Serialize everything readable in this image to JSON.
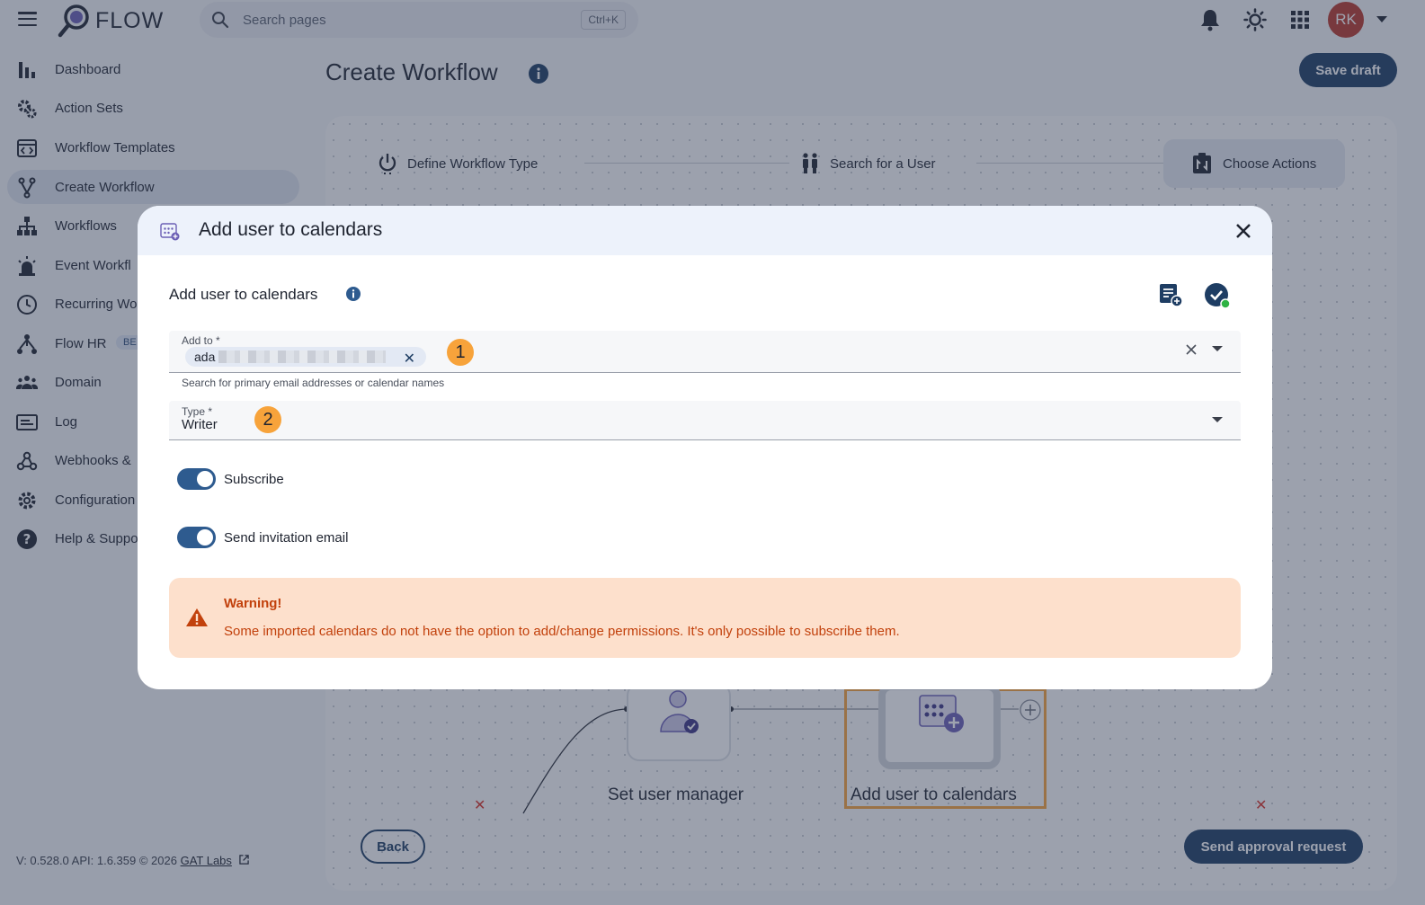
{
  "app": {
    "logo_text": "FLOW",
    "search_placeholder": "Search pages",
    "search_shortcut": "Ctrl+K",
    "avatar_initials": "RK"
  },
  "sidebar": {
    "items": [
      {
        "label": "Dashboard",
        "icon": "bar-chart-icon"
      },
      {
        "label": "Action Sets",
        "icon": "gears-icon"
      },
      {
        "label": "Workflow Templates",
        "icon": "template-icon"
      },
      {
        "label": "Create Workflow",
        "icon": "fork-icon",
        "active": true
      },
      {
        "label": "Workflows",
        "icon": "hierarchy-icon"
      },
      {
        "label": "Event Workfl",
        "icon": "alarm-icon"
      },
      {
        "label": "Recurring Wo",
        "icon": "clock-icon"
      },
      {
        "label": "Flow HR",
        "icon": "hr-icon",
        "badge": "BE"
      },
      {
        "label": "Domain",
        "icon": "group-icon"
      },
      {
        "label": "Log",
        "icon": "log-icon"
      },
      {
        "label": "Webhooks &",
        "icon": "webhook-icon"
      },
      {
        "label": "Configuration",
        "icon": "gear-icon"
      },
      {
        "label": "Help & Suppo",
        "icon": "help-icon"
      }
    ],
    "version_text": "V: 0.528.0   API: 1.6.359   © 2026 ",
    "company_link": "GAT Labs"
  },
  "main": {
    "title": "Create Workflow",
    "save_draft": "Save draft",
    "steps": [
      "Define Workflow Type",
      "Search for a User",
      "Choose Actions"
    ],
    "nodes": [
      "Set user manager",
      "Add user to calendars"
    ],
    "back": "Back",
    "send_approval": "Send approval request"
  },
  "modal": {
    "title": "Add user to calendars",
    "section_title": "Add user to calendars",
    "add_to_label": "Add to *",
    "chip_text": "ada",
    "badge1": "1",
    "helper": "Search for primary email addresses or calendar names",
    "type_label": "Type *",
    "type_value": "Writer",
    "badge2": "2",
    "subscribe_label": "Subscribe",
    "send_invitation_label": "Send invitation email",
    "warning_title": "Warning!",
    "warning_text": "Some imported calendars do not have the option to add/change permissions. It's only possible to subscribe them."
  },
  "colors": {
    "primary": "#1e3d63",
    "warning_bg": "#fde0cc",
    "warning_text": "#c2410c",
    "highlight": "#f7a33b"
  }
}
